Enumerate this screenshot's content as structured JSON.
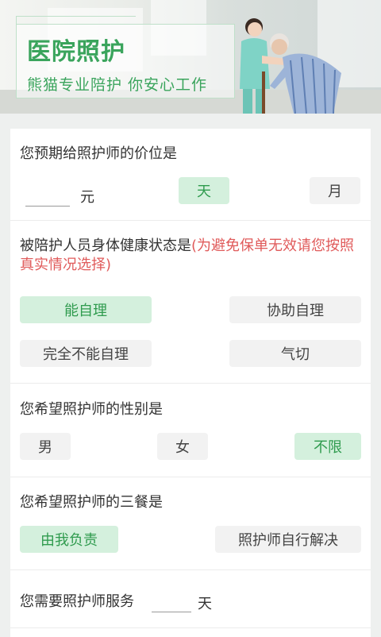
{
  "banner": {
    "title": "医院照护",
    "subtitle": "熊猫专业陪护  你安心工作"
  },
  "price": {
    "question": "您预期给照护师的价位是",
    "value": "",
    "unit": "元",
    "options": [
      {
        "label": "天",
        "selected": true
      },
      {
        "label": "月",
        "selected": false
      }
    ]
  },
  "health": {
    "question": "被陪护人员身体健康状态是",
    "warning": "(为避免保单无效请您按照真实情况选择)",
    "options": [
      {
        "label": "能自理",
        "selected": true
      },
      {
        "label": "协助自理",
        "selected": false
      },
      {
        "label": "完全不能自理",
        "selected": false
      },
      {
        "label": "气切",
        "selected": false
      }
    ]
  },
  "gender": {
    "question": "您希望照护师的性别是",
    "options": [
      {
        "label": "男",
        "selected": false
      },
      {
        "label": "女",
        "selected": false
      },
      {
        "label": "不限",
        "selected": true
      }
    ]
  },
  "meals": {
    "question": "您希望照护师的三餐是",
    "options": [
      {
        "label": "由我负责",
        "selected": true
      },
      {
        "label": "照护师自行解决",
        "selected": false
      }
    ]
  },
  "days": {
    "question": "您需要照护师服务",
    "value": "",
    "unit": "天"
  },
  "colors": {
    "accent": "#3aa45c",
    "selected_bg": "#d4f0dd",
    "warning": "#e05a5a"
  }
}
